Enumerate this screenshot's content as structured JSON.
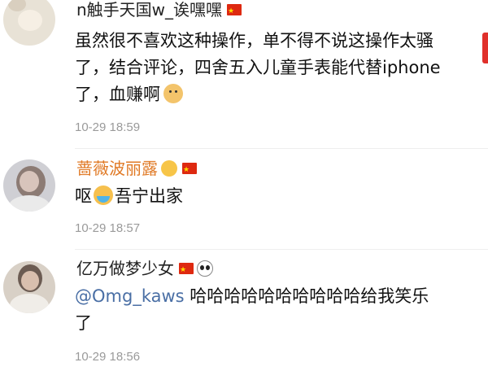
{
  "comments": [
    {
      "username": "n触手天国w_诶嘿嘿",
      "text_lines": [
        "虽然很不喜欢这种操作，单不得不说这操作太骚",
        "了，结合评论，四舍五入儿童手表能代替iphone",
        "了，血赚啊"
      ],
      "emoji": "doge-icon",
      "time": "10-29 18:59"
    },
    {
      "username": "蔷薇波丽露",
      "text_before": "呕",
      "emoji": "crying-face-icon",
      "text_after": "吾宁出家",
      "time": "10-29 18:57"
    },
    {
      "username": "亿万做梦少女",
      "mention": "@Omg_kaws",
      "text_line1": " 哈哈哈哈哈哈哈哈哈哈给我笑乐",
      "text_line2": "了",
      "time": "10-29 18:56"
    }
  ]
}
